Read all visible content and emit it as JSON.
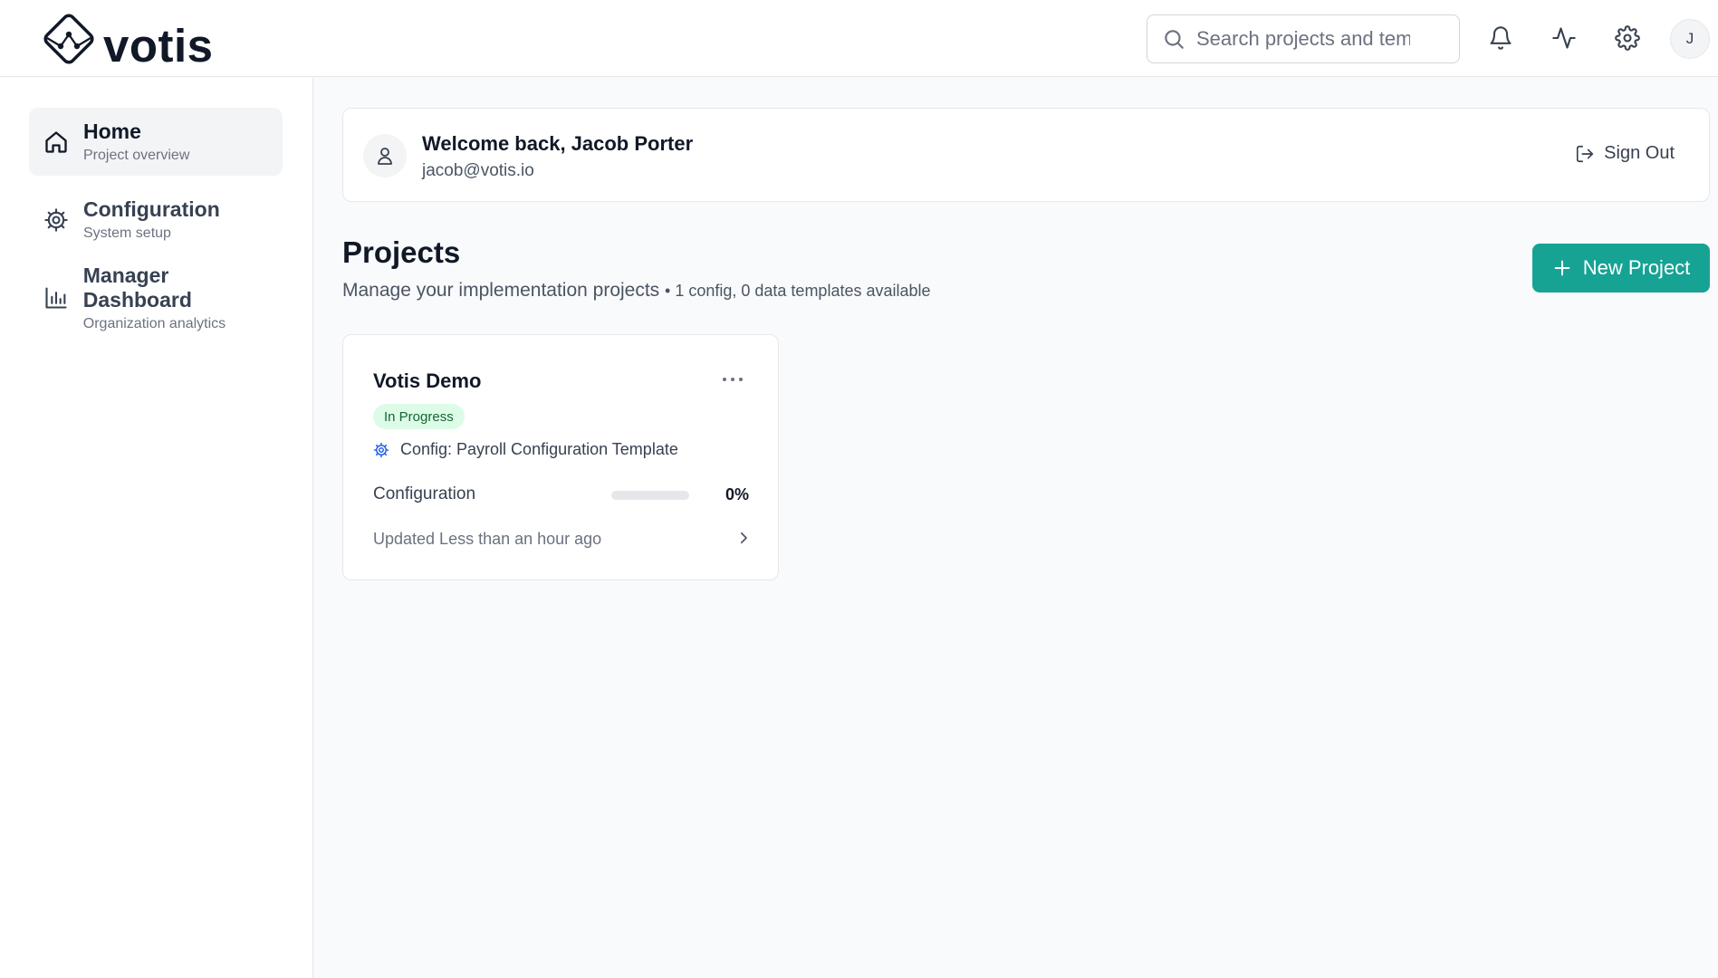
{
  "brand": {
    "name": "votis"
  },
  "header": {
    "search_placeholder": "Search projects and templates",
    "icons": [
      "bell-icon",
      "activity-icon",
      "gear-icon"
    ],
    "avatar_initial": "J"
  },
  "sidebar": {
    "items": [
      {
        "label": "Home",
        "sublabel": "Project overview",
        "icon": "home-icon",
        "active": true
      },
      {
        "label": "Configuration",
        "sublabel": "System setup",
        "icon": "gear-icon",
        "active": false
      },
      {
        "label": "Manager Dashboard",
        "sublabel": "Organization analytics",
        "icon": "bar-chart-icon",
        "active": false
      }
    ]
  },
  "welcome": {
    "greeting": "Welcome back, Jacob Porter",
    "email": "jacob@votis.io",
    "signout_label": "Sign Out"
  },
  "projects": {
    "title": "Projects",
    "subtitle": "Manage your implementation projects",
    "meta": "• 1 config, 0 data templates available",
    "new_button_label": "New Project",
    "cards": [
      {
        "name": "Votis Demo",
        "status": "In Progress",
        "config": "Config: Payroll Configuration Template",
        "progress_label": "Configuration",
        "progress_value": 0,
        "progress_text": "0%",
        "updated": "Updated Less than an hour ago"
      }
    ]
  },
  "colors": {
    "accent": "#16a394",
    "status_bg": "#dcfce7",
    "status_text": "#166534"
  }
}
